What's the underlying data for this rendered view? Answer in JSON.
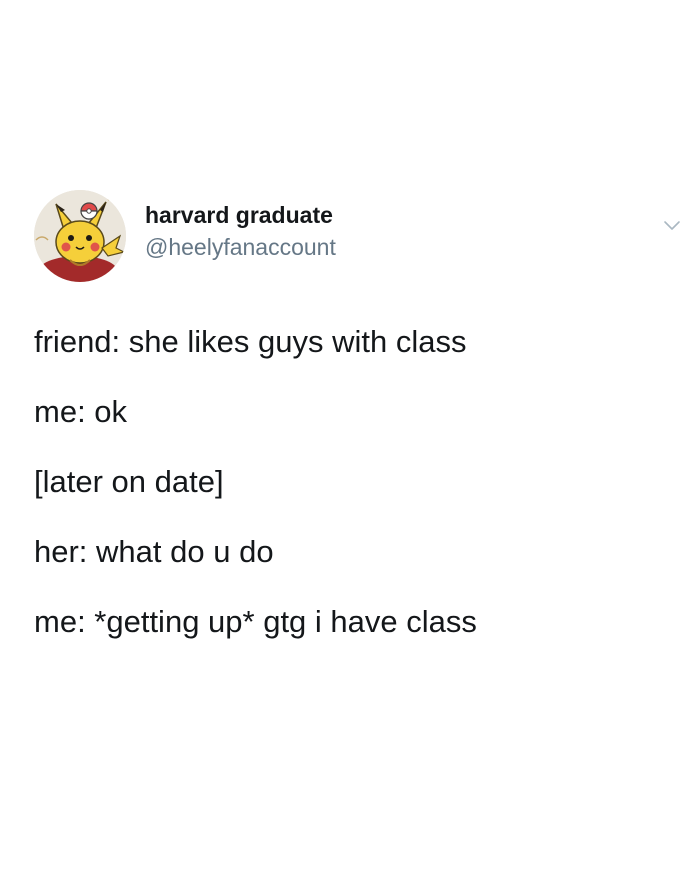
{
  "tweet": {
    "author": {
      "display_name": "harvard graduate",
      "handle": "@heelyfanaccount",
      "avatar_icon": "pikachu-avatar"
    },
    "menu_icon": "chevron-down-icon",
    "lines": [
      "friend: she likes guys with class",
      "me: ok",
      "[later on date]",
      "her: what do u do",
      "me: *getting up* gtg i have class"
    ]
  },
  "colors": {
    "background": "#ffffff",
    "text": "#14171a",
    "secondary_text": "#657786",
    "caret": "#aab8c2"
  }
}
